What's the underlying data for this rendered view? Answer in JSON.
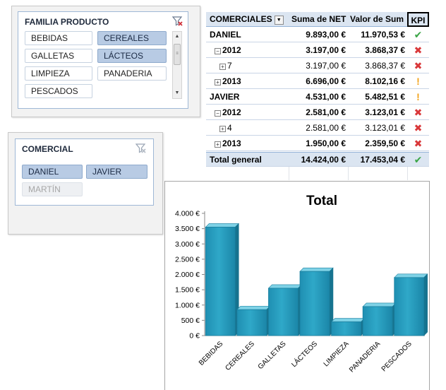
{
  "slicer_familia": {
    "title": "FAMILIA PRODUCTO",
    "items": [
      {
        "label": "BEBIDAS",
        "state": "normal"
      },
      {
        "label": "CEREALES",
        "state": "selected"
      },
      {
        "label": "GALLETAS",
        "state": "normal"
      },
      {
        "label": "LÁCTEOS",
        "state": "selected"
      },
      {
        "label": "LIMPIEZA",
        "state": "normal"
      },
      {
        "label": "PANADERIA",
        "state": "normal"
      },
      {
        "label": "PESCADOS",
        "state": "normal"
      }
    ]
  },
  "slicer_comercial": {
    "title": "COMERCIAL",
    "items": [
      {
        "label": "DANIEL",
        "state": "selected"
      },
      {
        "label": "JAVIER",
        "state": "selected"
      },
      {
        "label": "MARTÍN",
        "state": "nodata"
      }
    ]
  },
  "pivot": {
    "headers": {
      "c1": "COMERCIALES",
      "c2": "Suma de NET",
      "c3": "Valor de Sum",
      "c4": "KPI"
    },
    "rows": [
      {
        "label": "DANIEL",
        "net": "9.893,00 €",
        "valor": "11.970,53 €",
        "kpi": "ok",
        "level": 0
      },
      {
        "label": "2012",
        "net": "3.197,00 €",
        "valor": "3.868,37 €",
        "kpi": "bad",
        "level": 1,
        "expander": "minus"
      },
      {
        "label": "7",
        "net": "3.197,00 €",
        "valor": "3.868,37 €",
        "kpi": "bad",
        "level": 2,
        "expander": "plus"
      },
      {
        "label": "2013",
        "net": "6.696,00 €",
        "valor": "8.102,16 €",
        "kpi": "warn",
        "level": 1,
        "expander": "plus"
      },
      {
        "label": "JAVIER",
        "net": "4.531,00 €",
        "valor": "5.482,51 €",
        "kpi": "warn",
        "level": 0
      },
      {
        "label": "2012",
        "net": "2.581,00 €",
        "valor": "3.123,01 €",
        "kpi": "bad",
        "level": 1,
        "expander": "minus"
      },
      {
        "label": "4",
        "net": "2.581,00 €",
        "valor": "3.123,01 €",
        "kpi": "bad",
        "level": 2,
        "expander": "plus"
      },
      {
        "label": "2013",
        "net": "1.950,00 €",
        "valor": "2.359,50 €",
        "kpi": "bad",
        "level": 1,
        "expander": "plus"
      }
    ],
    "total": {
      "label": "Total general",
      "net": "14.424,00 €",
      "valor": "17.453,04 €",
      "kpi": "ok"
    }
  },
  "icons": {
    "ok": "✔",
    "bad": "✖",
    "warn": "!"
  },
  "colors": {
    "ok": "#3aa546",
    "bad": "#d9383a",
    "warn": "#f2a31b",
    "bar": "#2fa8c8",
    "selected": "#b8cbe4"
  },
  "chart_data": {
    "type": "bar",
    "title": "Total",
    "categories": [
      "BEBIDAS",
      "CEREALES",
      "GALLETAS",
      "LÁCTEOS",
      "LIMPIEZA",
      "PANADERIA",
      "PESCADOS"
    ],
    "values": [
      3550,
      850,
      1550,
      2100,
      450,
      950,
      1900
    ],
    "ylim": [
      0,
      4000
    ],
    "yticks": [
      "0 €",
      "500 €",
      "1.000 €",
      "1.500 €",
      "2.000 €",
      "2.500 €",
      "3.000 €",
      "3.500 €",
      "4.000 €"
    ],
    "ytick_values": [
      0,
      500,
      1000,
      1500,
      2000,
      2500,
      3000,
      3500,
      4000
    ],
    "xlabel": "",
    "ylabel": "",
    "grid": false,
    "legend": "none"
  }
}
